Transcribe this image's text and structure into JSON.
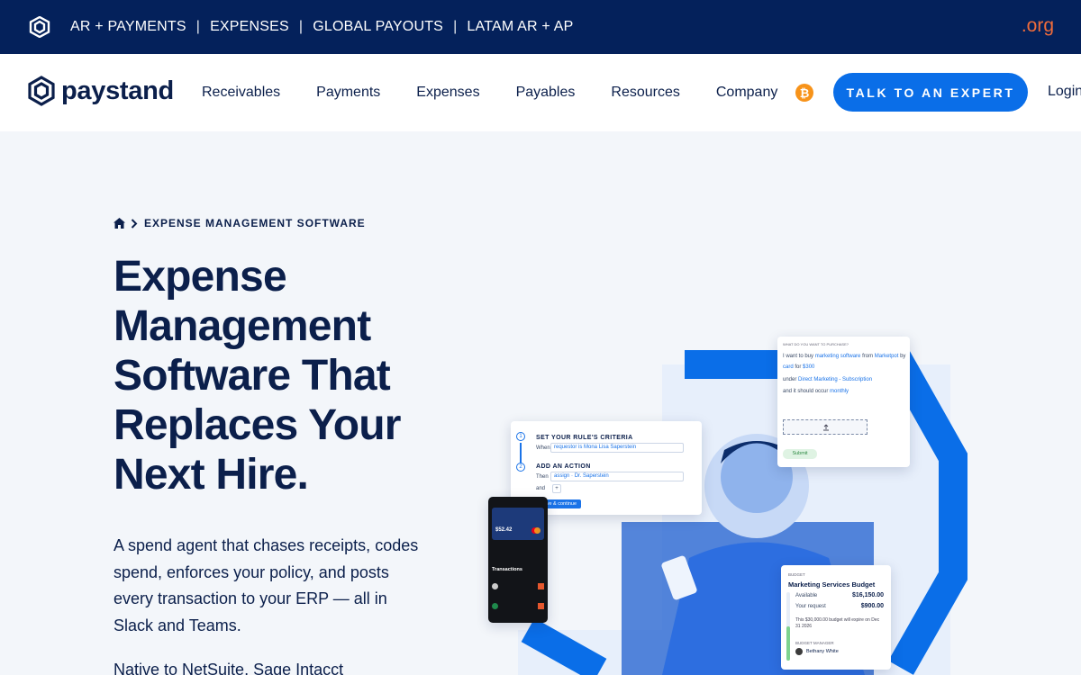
{
  "topbar": {
    "links": [
      "AR + PAYMENTS",
      "EXPENSES",
      "GLOBAL PAYOUTS",
      "LATAM AR + AP"
    ],
    "org_label": ".org"
  },
  "nav": {
    "brand": "paystand",
    "menu": [
      "Receivables",
      "Payments",
      "Expenses",
      "Payables",
      "Resources",
      "Company"
    ],
    "cta_label": "TALK TO AN EXPERT",
    "login_label": "Login"
  },
  "hero": {
    "breadcrumb": "EXPENSE MANAGEMENT SOFTWARE",
    "headline": "Expense Management Software That Replaces Your Next Hire.",
    "subcopy": "A spend agent that chases receipts, codes spend, enforces your policy, and posts every transaction to your ERP — all in Slack and Teams.",
    "native_line": "Native to NetSuite, Sage Intacct"
  },
  "rule_card": {
    "step1_title": "SET YOUR RULE'S CRITERIA",
    "step1_when": "When",
    "step1_value": "requestor is Mona Lisa Saperstein",
    "step2_title": "ADD AN ACTION",
    "step2_then": "Then",
    "step2_action": "assign",
    "step2_person": "Dr. Saperstein",
    "step2_and": "and",
    "save_label": "Save & continue"
  },
  "request_card": {
    "header": "WHAT DO YOU WANT TO PURCHASE?",
    "line1_prefix": "I want to buy",
    "line1_item": "marketing software",
    "line1_from": "from",
    "line1_vendor": "Marketpot",
    "line1_by": "by",
    "line2_method": "card",
    "line2_for": "for",
    "line2_amount": "$300",
    "line3_under": "under",
    "line3_category": "Direct Marketing - Subscription",
    "line4_prefix": "and it should occur",
    "line4_freq": "monthly",
    "submit_label": "Submit"
  },
  "phone": {
    "balance": "$52.42",
    "section": "Transactions"
  },
  "budget_card": {
    "label": "BUDGET",
    "title": "Marketing Services Budget",
    "available_label": "Available",
    "available_value": "$16,150.00",
    "request_label": "Your request",
    "request_value": "$900.00",
    "note": "This $30,000.00 budget will expire on Dec 31 2026",
    "manager_label": "BUDGET MANAGER",
    "manager_name": "Bethany White"
  },
  "colors": {
    "topbar": "#04215b",
    "accent": "#0a6ee8",
    "org": "#f06c3b",
    "bitcoin": "#f7931a"
  }
}
